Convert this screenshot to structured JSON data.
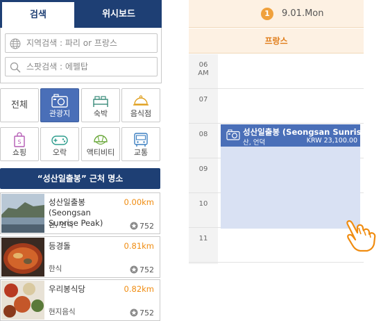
{
  "tabs": {
    "search": "검색",
    "wishboard": "위시보드"
  },
  "search": {
    "region_placeholder": "지역검색 : 파리 or 프랑스",
    "spot_placeholder": "스팟검색 : 에펠탑"
  },
  "categories": {
    "all": "전체",
    "items": [
      {
        "label": "관광지",
        "icon": "camera-icon",
        "active": true
      },
      {
        "label": "숙박",
        "icon": "bed-icon"
      },
      {
        "label": "음식점",
        "icon": "cloche-icon"
      },
      {
        "label": "쇼핑",
        "icon": "shopping-bag-icon"
      },
      {
        "label": "오락",
        "icon": "gamepad-icon"
      },
      {
        "label": "액티비티",
        "icon": "helmet-icon"
      },
      {
        "label": "교통",
        "icon": "bus-icon"
      }
    ]
  },
  "nearby": {
    "header": "“성산일출봉” 근처 명소",
    "places": [
      {
        "name": "성산일출봉 (Seongsan Sunrise Peak)",
        "distance": "0.00km",
        "category": "산, 언덕",
        "count": "752"
      },
      {
        "name": "등경돌",
        "distance": "0.81km",
        "category": "한식",
        "count": "752"
      },
      {
        "name": "우리봉식당",
        "distance": "0.82km",
        "category": "현지음식",
        "count": "752"
      }
    ]
  },
  "calendar": {
    "day_number": "1",
    "date_label": "9.01.Mon",
    "region": "프랑스",
    "times": [
      {
        "hour": "06",
        "suffix": "AM"
      },
      {
        "hour": "07",
        "suffix": ""
      },
      {
        "hour": "08",
        "suffix": ""
      },
      {
        "hour": "09",
        "suffix": ""
      },
      {
        "hour": "10",
        "suffix": ""
      },
      {
        "hour": "11",
        "suffix": ""
      }
    ],
    "event": {
      "title": "성산일출봉 (Seongsan Sunrise Peak)",
      "category": "산, 언덕",
      "price": "KRW 23,100.00"
    }
  },
  "colors": {
    "navy": "#1e3f74",
    "accent_blue": "#4a6fb8",
    "orange": "#f08c10",
    "cream": "#fdf1e3"
  }
}
